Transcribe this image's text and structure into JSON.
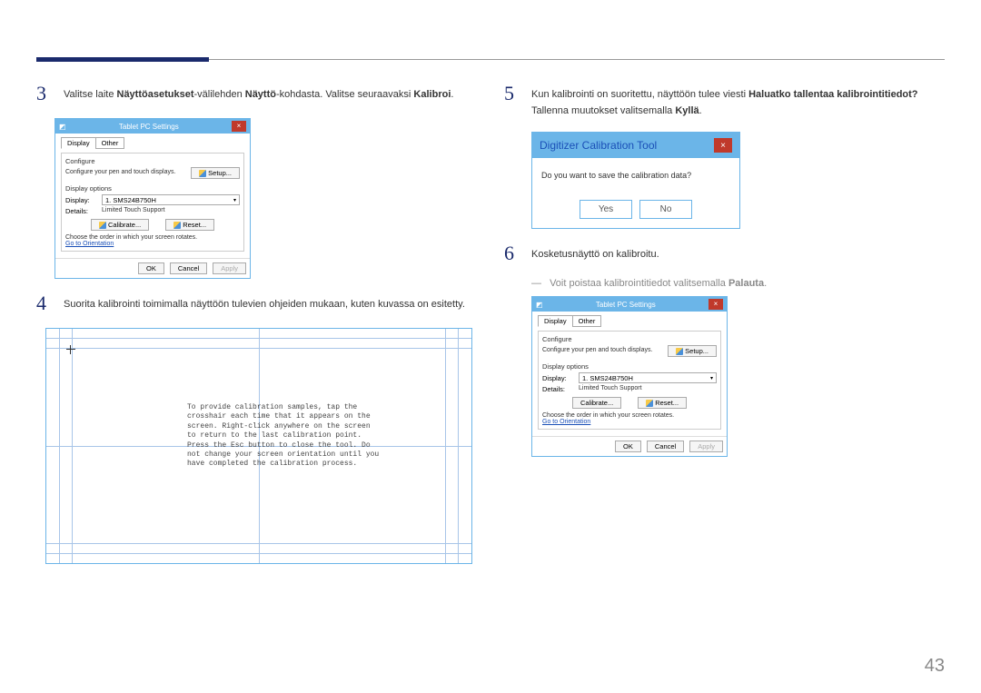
{
  "page_number": "43",
  "step3": {
    "num": "3",
    "text_pre": "Valitse laite ",
    "b1": "Näyttöasetukset",
    "text_mid1": "-välilehden ",
    "b2": "Näyttö",
    "text_mid2": "-kohdasta. Valitse seuraavaksi ",
    "b3": "Kalibroi",
    "text_end": "."
  },
  "step4": {
    "num": "4",
    "text": "Suorita kalibrointi toimimalla näyttöön tulevien ohjeiden mukaan, kuten kuvassa on esitetty."
  },
  "step5": {
    "num": "5",
    "text_pre": "Kun kalibrointi on suoritettu, näyttöön tulee viesti ",
    "b1": "Haluatko tallentaa kalibrointitiedot?",
    "text_mid": " Tallenna muutokset valitsemalla ",
    "b2": "Kyllä",
    "text_end": "."
  },
  "step6": {
    "num": "6",
    "text": "Kosketusnäyttö on kalibroitu."
  },
  "note": {
    "text_pre": "Voit poistaa kalibrointitiedot valitsemalla ",
    "b": "Palauta",
    "text_end": "."
  },
  "tablet_dialog": {
    "title": "Tablet PC Settings",
    "tab_display": "Display",
    "tab_other": "Other",
    "configure": "Configure",
    "configure_desc": "Configure your pen and touch displays.",
    "setup": "Setup...",
    "display_options": "Display options",
    "display_label": "Display:",
    "display_value": "1. SMS24B750H",
    "details_label": "Details:",
    "details_value": "Limited Touch Support",
    "calibrate": "Calibrate...",
    "reset": "Reset...",
    "rotate_text": "Choose the order in which your screen rotates.",
    "orientation_link": "Go to Orientation",
    "ok": "OK",
    "cancel": "Cancel",
    "apply": "Apply"
  },
  "calib_screen": {
    "text": "To provide calibration samples, tap the crosshair each time that it appears on the screen.\nRight-click anywhere on the screen to return to the last calibration point. Press the Esc button to close the tool. Do not change your screen orientation until you have completed the calibration process."
  },
  "digitizer": {
    "title": "Digitizer Calibration Tool",
    "question": "Do you want to save the calibration data?",
    "yes": "Yes",
    "no": "No"
  }
}
